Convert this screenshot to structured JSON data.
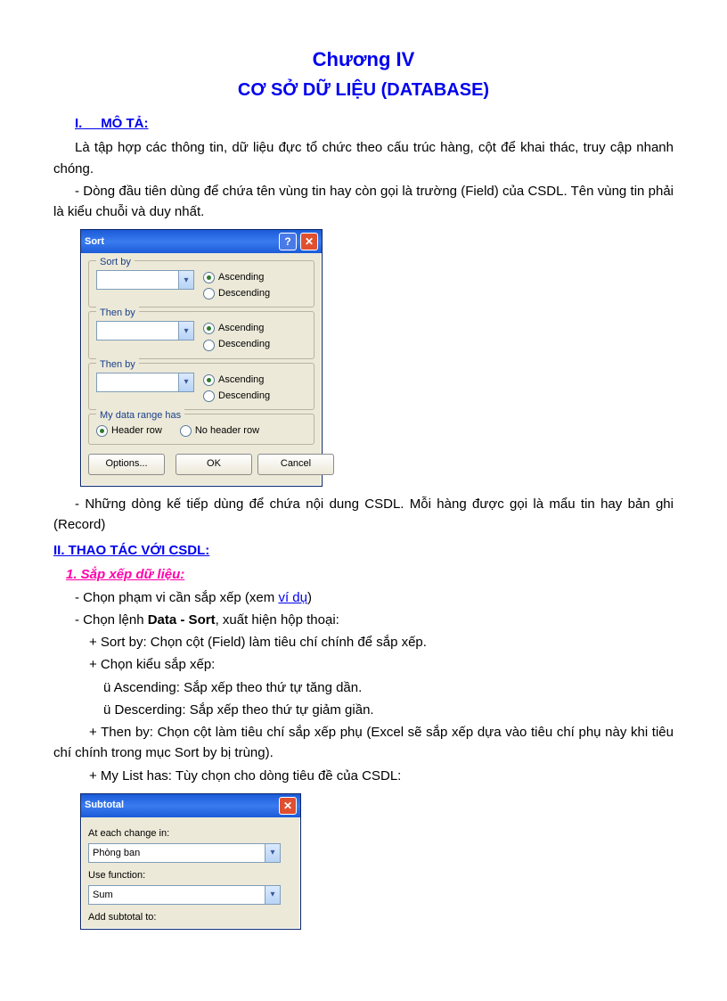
{
  "doc": {
    "title": "Chương IV",
    "subtitle": "CƠ SỞ DỮ LIỆU (DATABASE)",
    "h1_mota_prefix": "I.",
    "h1_mota": "MÔ TẢ:",
    "p1": "Là tập hợp các thông tin, dữ liệu đực tổ chức theo cấu trúc hàng, cột để khai thác, truy cập nhanh chóng.",
    "p2": "- Dòng đầu tiên dùng để chứa tên vùng tin hay còn gọi là trường (Field) của CSDL. Tên vùng tin phải là  kiểu chuỗi và duy nhất.",
    "p3": "- Những dòng kế tiếp dùng để chứa nội dung CSDL. Mỗi hàng được gọi là mẩu tin hay bản ghi (Record)",
    "h1_thaotac": "II. THAO TÁC VỚI CSDL:",
    "h2_sapxep": "1. Sắp xếp dữ liệu:",
    "p4a": "- Chọn phạm vi cần sắp xếp (xem ",
    "p4_link": "ví dụ",
    "p4b": ")",
    "p5a": "- Chọn lệnh ",
    "p5_cmd": "Data - Sort",
    "p5b": ", xuất hiện hộp thoại:",
    "p6": "+ Sort by: Chọn cột (Field) làm tiêu chí chính để sắp xếp.",
    "p7": "+ Chọn kiểu sắp xếp:",
    "p8": "ü Ascending: Sắp xếp theo thứ tự tăng dần.",
    "p9": "ü Descerding: Sắp xếp theo thứ tự giảm giần.",
    "p10": "+ Then by: Chọn cột làm tiêu chí sắp xếp phụ (Excel sẽ sắp xếp dựa vào tiêu chí phụ này khi tiêu chí chính trong mục Sort by bị trùng).",
    "p11": "+ My List has: Tùy chọn cho dòng tiêu đề của CSDL:"
  },
  "sortdlg": {
    "title": "Sort",
    "help_glyph": "?",
    "close_glyph": "✕",
    "sortby": "Sort by",
    "thenby": "Then by",
    "asc": "Ascending",
    "desc": "Descending",
    "mydata": "My data range has",
    "headerrow": "Header row",
    "noheader": "No header row",
    "options": "Options...",
    "ok": "OK",
    "cancel": "Cancel",
    "arrow": "▾"
  },
  "subdlg": {
    "title": "Subtotal",
    "close_glyph": "✕",
    "ateach": "At each change in:",
    "ateach_val": "Phòng ban",
    "usefn": "Use function:",
    "usefn_val": "Sum",
    "addsub": "Add subtotal to:",
    "arrow": "▾"
  }
}
